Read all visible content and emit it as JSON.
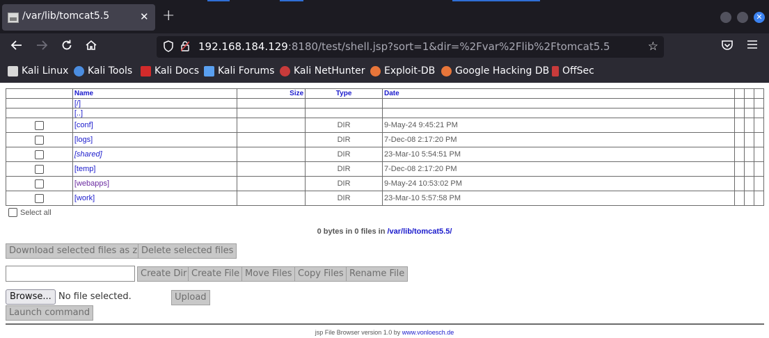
{
  "browser": {
    "tab_title": "/var/lib/tomcat5.5",
    "tab_close": "✕",
    "new_tab": "+",
    "url_host": "192.168.184.129",
    "url_rest": ":8180/test/shell.jsp?sort=1&dir=%2Fvar%2Flib%2Ftomcat5.5",
    "accent_color": "#3b82f0",
    "bookmarks": [
      {
        "label": "Kali Linux",
        "icon": "kali-dragon-icon",
        "color": "#d8d8d8"
      },
      {
        "label": "Kali Tools",
        "icon": "kali-tools-icon",
        "color": "#4b8de0"
      },
      {
        "label": "Kali Docs",
        "icon": "kali-docs-icon",
        "color": "#d22b2b"
      },
      {
        "label": "Kali Forums",
        "icon": "kali-forums-icon",
        "color": "#5aa0f0"
      },
      {
        "label": "Kali NetHunter",
        "icon": "nethunter-icon",
        "color": "#c83b3b"
      },
      {
        "label": "Exploit-DB",
        "icon": "exploit-db-icon",
        "color": "#e8763a"
      },
      {
        "label": "Google Hacking DB",
        "icon": "ghdb-icon",
        "color": "#e8763a"
      },
      {
        "label": "OffSec",
        "icon": "offsec-icon",
        "color": "#c83b3b"
      }
    ]
  },
  "table": {
    "headers": {
      "name": "Name",
      "size": "Size",
      "type": "Type",
      "date": "Date"
    },
    "nav_links": [
      "[/]",
      "[..]"
    ],
    "rows": [
      {
        "name": "[conf]",
        "type": "DIR",
        "date": "9-May-24 9:45:21 PM",
        "style": "normal"
      },
      {
        "name": "[logs]",
        "type": "DIR",
        "date": "7-Dec-08 2:17:20 PM",
        "style": "normal"
      },
      {
        "name": "[shared]",
        "type": "DIR",
        "date": "23-Mar-10 5:54:51 PM",
        "style": "italic"
      },
      {
        "name": "[temp]",
        "type": "DIR",
        "date": "7-Dec-08 2:17:20 PM",
        "style": "normal"
      },
      {
        "name": "[webapps]",
        "type": "DIR",
        "date": "9-May-24 10:53:02 PM",
        "style": "visited"
      },
      {
        "name": "[work]",
        "type": "DIR",
        "date": "23-Mar-10 5:57:58 PM",
        "style": "normal"
      }
    ]
  },
  "select_all": "Select all",
  "summary": {
    "text": "0 bytes in 0 files in ",
    "path": "/var/lib/tomcat5.5/"
  },
  "buttons": {
    "download_zip": "Download selected files as zip",
    "delete_selected": "Delete selected files",
    "create_dir": "Create Dir",
    "create_file": "Create File",
    "move_files": "Move Files",
    "copy_files": "Copy Files",
    "rename_file": "Rename File",
    "browse": "Browse...",
    "no_file": "No file selected.",
    "upload": "Upload",
    "launch_command": "Launch command"
  },
  "footer": {
    "text": "jsp File Browser version 1.0 by ",
    "link": "www.vonloesch.de"
  }
}
